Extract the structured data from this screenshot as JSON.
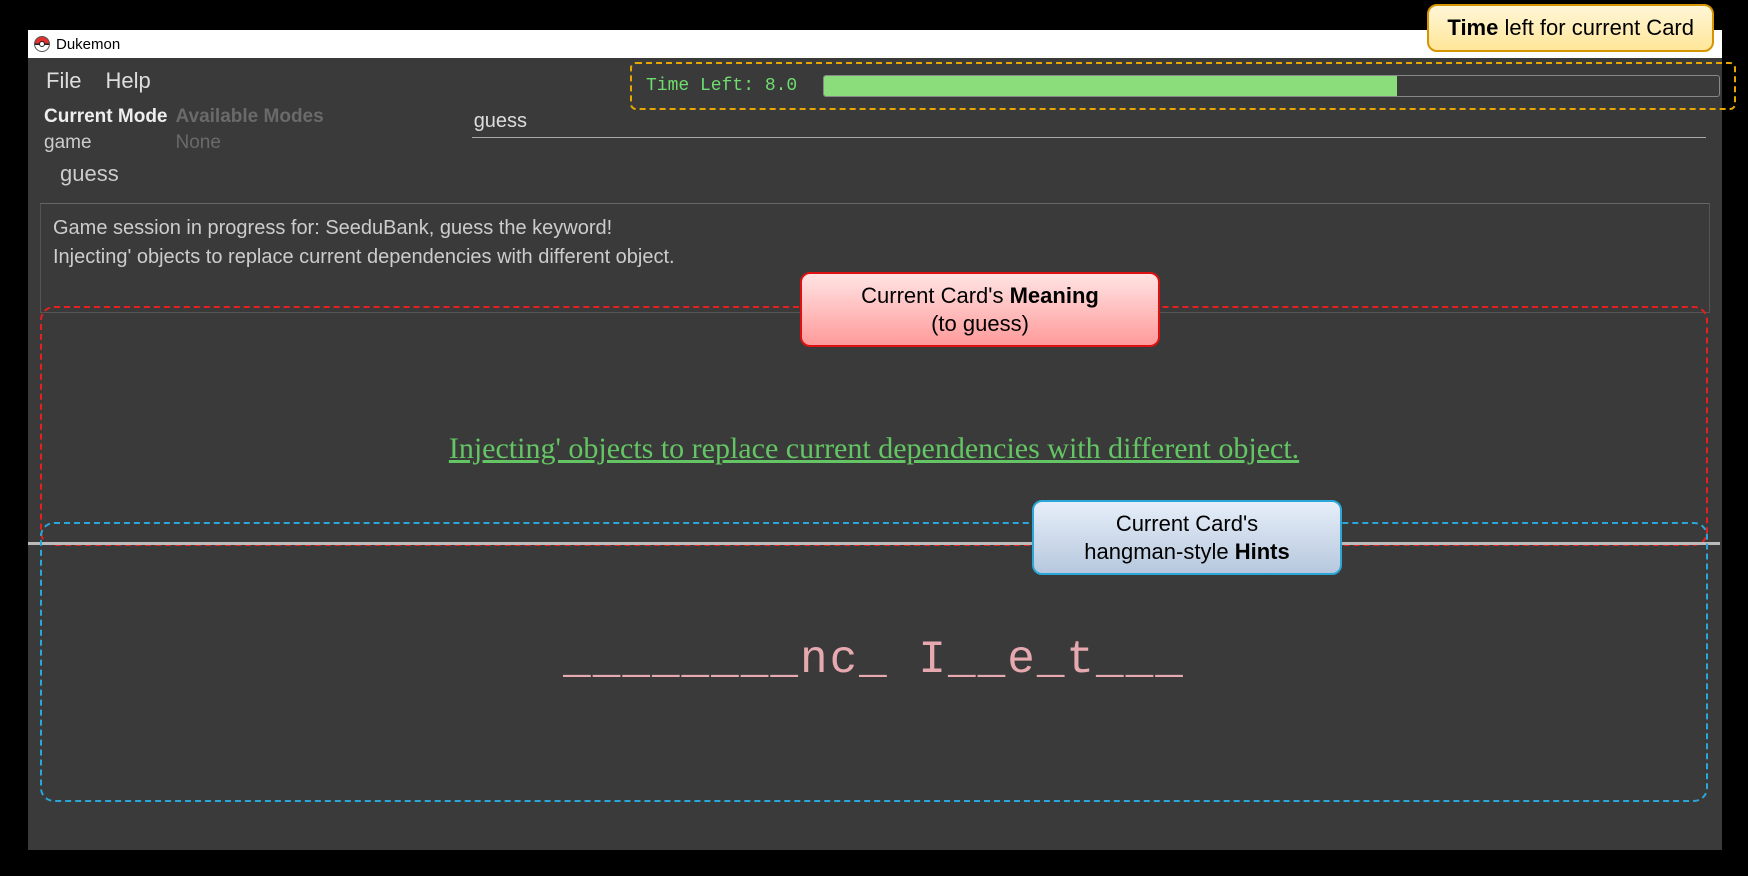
{
  "window": {
    "title": "Dukemon"
  },
  "menu": {
    "file": "File",
    "help": "Help"
  },
  "timer": {
    "label_prefix": "Time Left: ",
    "value": "8.0",
    "progress_percent": 64
  },
  "mode": {
    "current_label": "Current Mode",
    "current_value": "game",
    "available_label": "Available Modes",
    "available_value": "None"
  },
  "command": {
    "value": "guess",
    "suggestion": "guess"
  },
  "session": {
    "line1": "Game session in progress for: SeeduBank, guess the keyword!",
    "line2": "Injecting' objects to replace current dependencies with different object."
  },
  "card": {
    "meaning": "Injecting' objects to replace current dependencies with different object.",
    "hint": "________nc_ I__e_t___"
  },
  "callouts": {
    "time_pre": "Time",
    "time_post": " left for current Card",
    "meaning_pre": "Current Card's ",
    "meaning_bold": "Meaning",
    "meaning_line2": "(to guess)",
    "hint_line1": "Current Card's",
    "hint_pre": "hangman-style ",
    "hint_bold": "Hints"
  }
}
